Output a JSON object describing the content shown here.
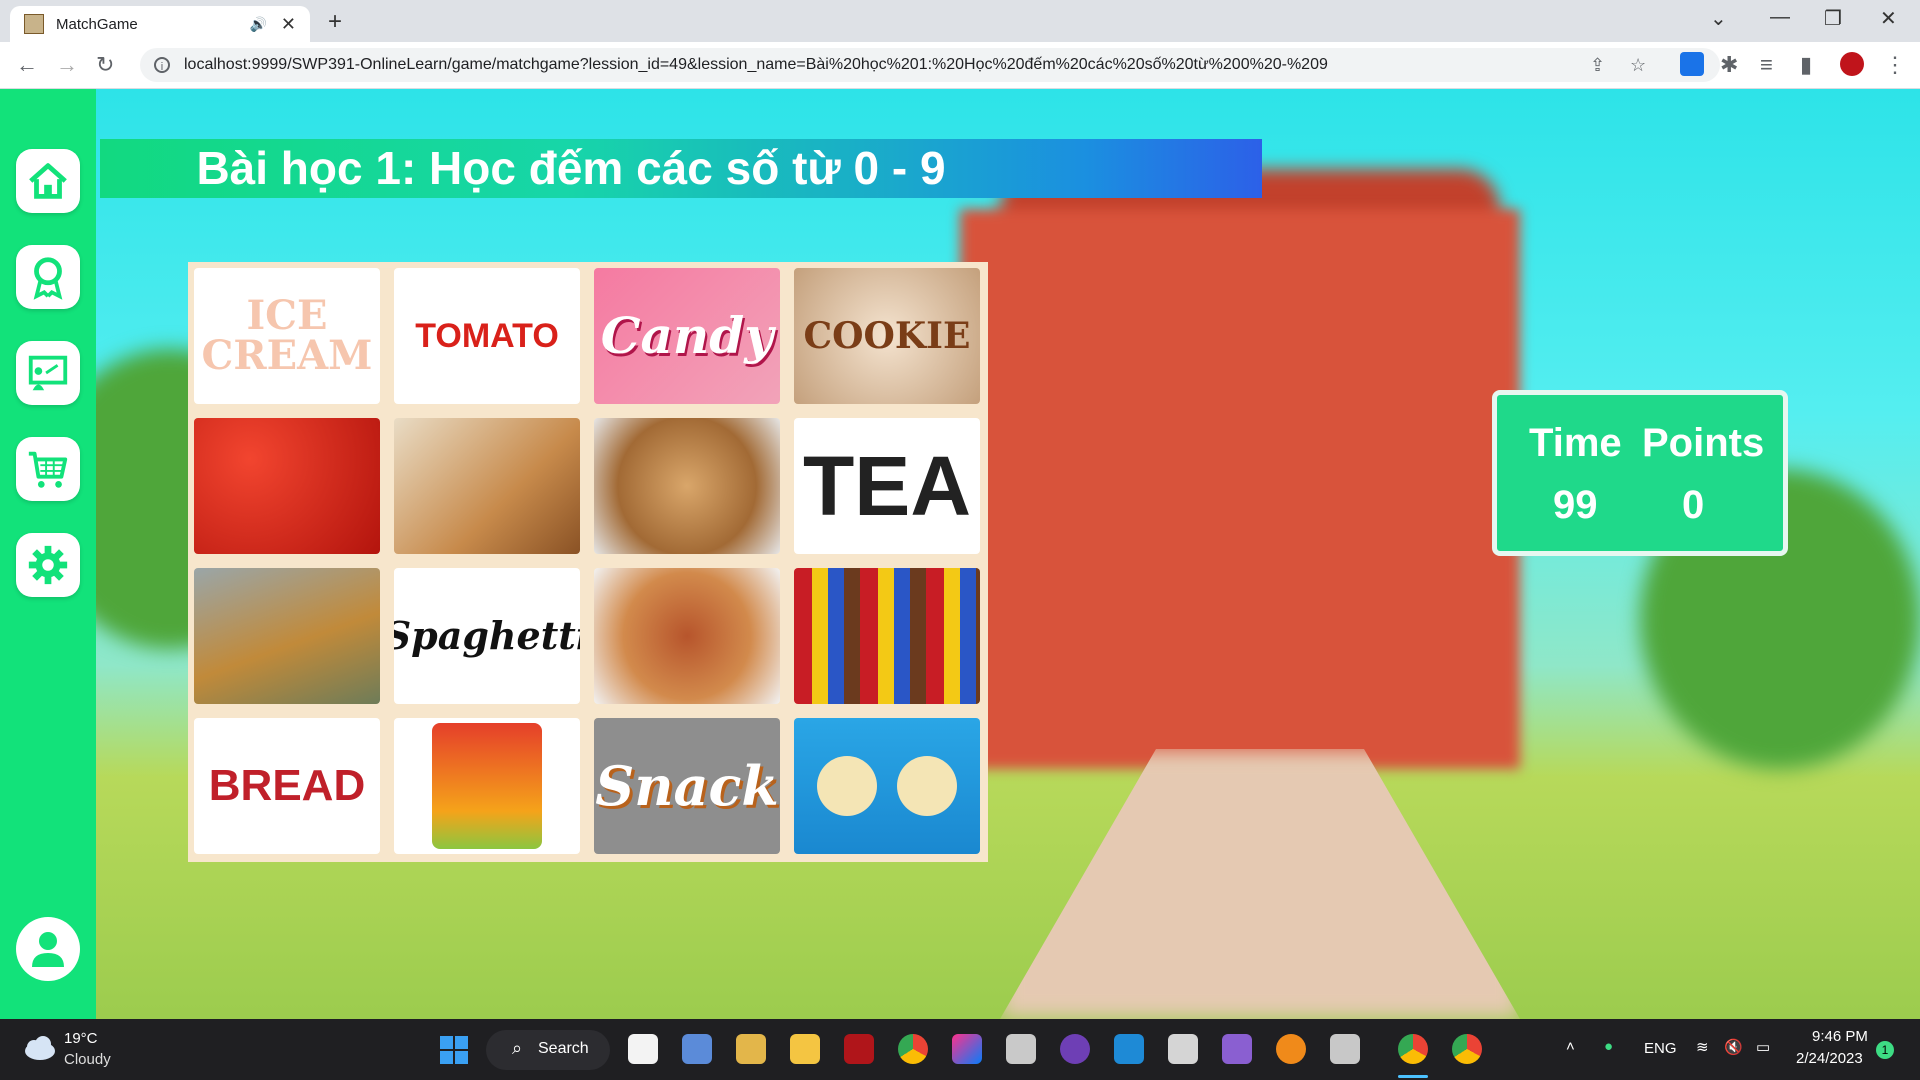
{
  "browser": {
    "tab_title": "MatchGame",
    "url": "localhost:9999/SWP391-OnlineLearn/game/matchgame?lession_id=49&lession_name=Bài%20học%201:%20Học%20đếm%20các%20số%20từ%200%20-%209"
  },
  "page": {
    "title": "Bài học 1: Học đếm các số từ 0 - 9",
    "cards": [
      {
        "label": "ICE CREAM",
        "style": "text"
      },
      {
        "label": "TOMATO",
        "style": "text"
      },
      {
        "label": "Candy",
        "style": "text"
      },
      {
        "label": "COOKIE",
        "style": "text"
      },
      {
        "label": "",
        "style": "image-tomatoes"
      },
      {
        "label": "",
        "style": "image-bread"
      },
      {
        "label": "",
        "style": "image-cookies"
      },
      {
        "label": "TEA",
        "style": "text"
      },
      {
        "label": "",
        "style": "image-tea"
      },
      {
        "label": "Spaghetti",
        "style": "text"
      },
      {
        "label": "",
        "style": "image-spaghetti"
      },
      {
        "label": "",
        "style": "image-snacks"
      },
      {
        "label": "BREAD",
        "style": "text"
      },
      {
        "label": "",
        "style": "image-corn-chip"
      },
      {
        "label": "Snack",
        "style": "text"
      },
      {
        "label": "",
        "style": "image-ice-cream"
      }
    ],
    "score": {
      "time_label": "Time",
      "points_label": "Points",
      "time_value": "99",
      "points_value": "0"
    }
  },
  "sidebar": {
    "items": [
      "home-icon",
      "award-icon",
      "classroom-icon",
      "cart-icon",
      "gear-icon"
    ],
    "bottom": "user-icon"
  },
  "taskbar": {
    "temperature": "19°C",
    "condition": "Cloudy",
    "search_label": "Search",
    "language": "ENG",
    "time": "9:46 PM",
    "date": "2/24/2023",
    "notification_count": "1"
  },
  "colors": {
    "sidebar": "#12e27a",
    "score_panel": "#1fd98a",
    "title_gradient_start": "#12d980",
    "title_gradient_end": "#2c60e8"
  }
}
